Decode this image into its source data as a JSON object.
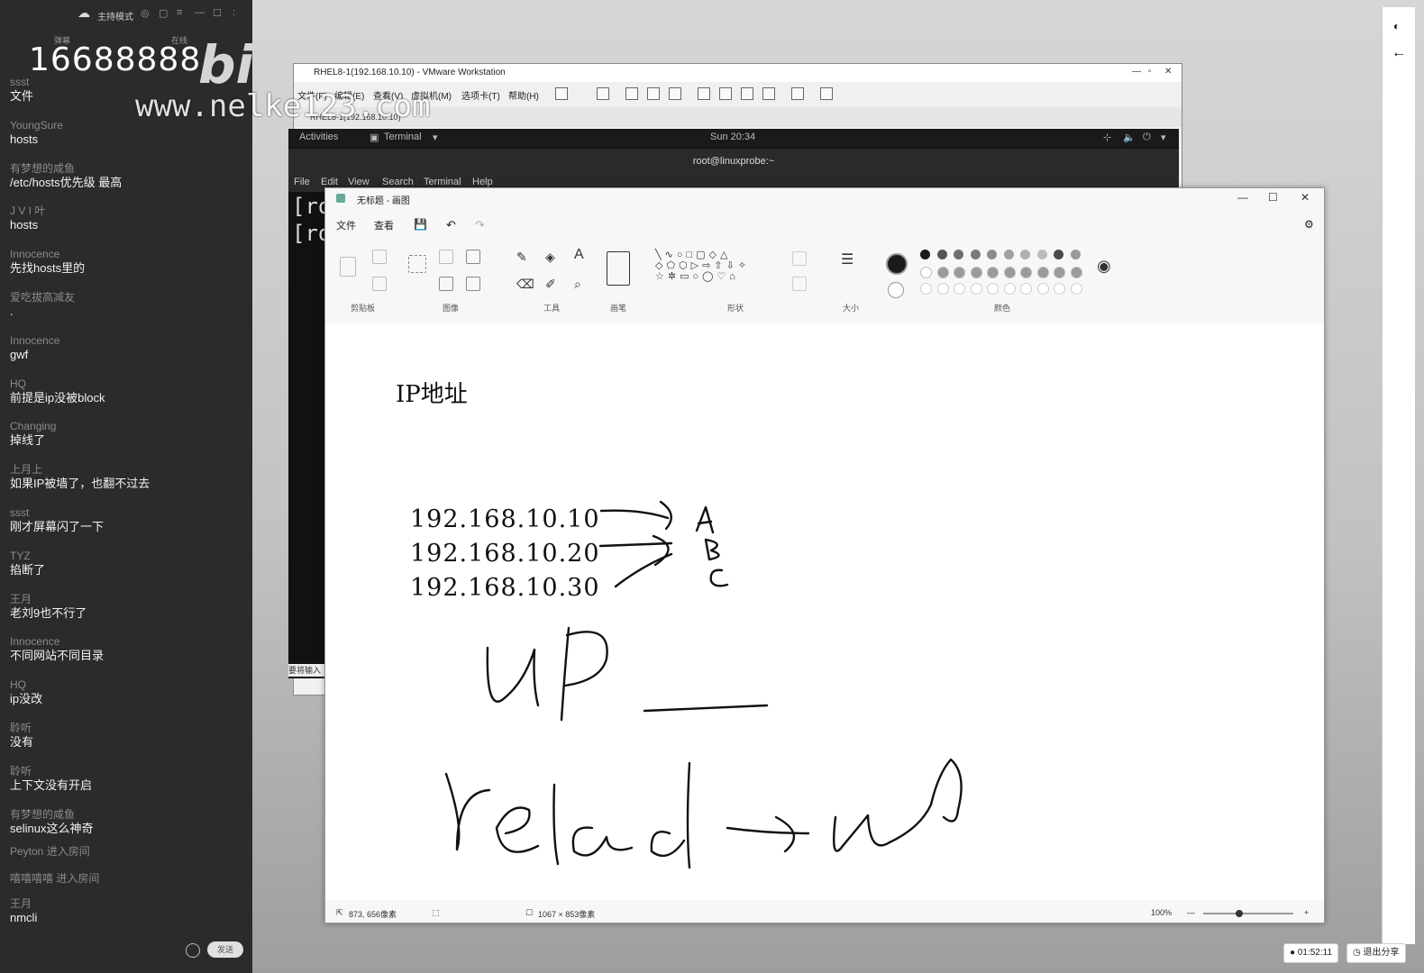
{
  "chat": {
    "mode": "主持模式",
    "viewer_count": "16688888",
    "tab_left": "弹幕",
    "tab_right": "在线",
    "logo": "bilibili",
    "watermark": "www.nelke123.com",
    "messages": [
      {
        "user": "ssst",
        "text": "文件"
      },
      {
        "user": "YoungSure",
        "text": "hosts"
      },
      {
        "user": "有梦想的咸鱼",
        "text": "/etc/hosts优先级 最高"
      },
      {
        "user": "J V I 叶",
        "text": "hosts"
      },
      {
        "user": "Innocence",
        "text": "先找hosts里的"
      },
      {
        "user": "爱吃拔高减友",
        "text": "."
      },
      {
        "user": "Innocence",
        "text": "gwf"
      },
      {
        "user": "HQ",
        "text": "前提是ip没被block"
      },
      {
        "user": "Changing",
        "text": "掉线了"
      },
      {
        "user": "上月上",
        "text": "如果IP被墙了，也翻不过去"
      },
      {
        "user": "ssst",
        "text": "刚才屏幕闪了一下"
      },
      {
        "user": "TYZ",
        "text": "掐断了"
      },
      {
        "user": "王月",
        "text": "老刘9也不行了"
      },
      {
        "user": "Innocence",
        "text": "不同网站不同目录"
      },
      {
        "user": "HQ",
        "text": "ip没改"
      },
      {
        "user": "聆听",
        "text": "没有"
      },
      {
        "user": "聆听",
        "text": "上下文没有开启"
      },
      {
        "user": "有梦想的咸鱼",
        "text": "selinux这么神奇"
      }
    ],
    "enter_notices": [
      "Peyton 进入房间",
      "嘻嘻嘻嘻 进入房间"
    ],
    "last_message": {
      "user": "王月",
      "text": "nmcli"
    },
    "send_label": "发送"
  },
  "vmware": {
    "title": "RHEL8-1(192.168.10.10) - VMware Workstation",
    "menus": [
      "文件(F)",
      "编辑(E)",
      "查看(V)",
      "虚拟机(M)",
      "选项卡(T)",
      "帮助(H)"
    ],
    "tab": "RHEL8-1(192.168.10.10)"
  },
  "guest": {
    "activities": "Activities",
    "app": "Terminal",
    "clock": "Sun 20:34",
    "terminal_title": "root@linuxprobe:~",
    "terminal_menu": [
      "File",
      "Edit",
      "View",
      "Search",
      "Terminal",
      "Help"
    ],
    "prompt_lines": [
      "[ro",
      "[ro"
    ],
    "ime_hint": "要将输入"
  },
  "paint": {
    "title": "无标题 - 画图",
    "menus": [
      "文件",
      "查看"
    ],
    "groups": [
      "剪贴板",
      "图像",
      "工具",
      "画笔",
      "形状",
      "大小",
      "颜色"
    ],
    "canvas": {
      "heading": "IP地址",
      "ips": [
        "192.168.10.10",
        "192.168.10.20",
        "192.168.10.30"
      ]
    },
    "status": {
      "cursor": "873, 656像素",
      "size": "1067 × 853像素",
      "zoom": "100%"
    },
    "colors": [
      "#1a1a1a",
      "#555555",
      "#6e6e6e",
      "#7a7a7a",
      "#8c8c8c",
      "#a0a0a0",
      "#b0b0b0",
      "#bdbdbd",
      "#4a4a4a",
      "#999999"
    ]
  },
  "taskbar": {
    "timer": "01:52:11",
    "share": "退出分享"
  }
}
